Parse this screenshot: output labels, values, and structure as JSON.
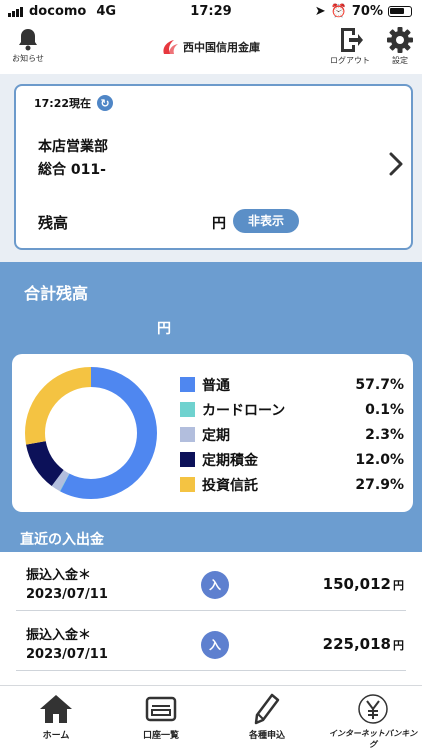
{
  "status_bar": {
    "carrier": "docomo",
    "network": "4G",
    "time": "17:29",
    "battery": "70%"
  },
  "header": {
    "notice_label": "お知らせ",
    "logo_text": "西中国信用金庫",
    "logout_label": "ログアウト",
    "settings_label": "設定"
  },
  "account_card": {
    "as_of": "17:22現在",
    "branch": "本店営業部",
    "account": "総合 011-",
    "balance_label": "残高",
    "currency": "円",
    "hide_label": "非表示"
  },
  "total": {
    "title": "合計残高",
    "currency": "円"
  },
  "chart_data": {
    "type": "pie",
    "title": "",
    "labels": [
      "普通",
      "カードローン",
      "定期",
      "定期積金",
      "投資信託"
    ],
    "values": [
      57.7,
      0.1,
      2.3,
      12.0,
      27.9
    ],
    "display_values": [
      "57.7%",
      "0.1%",
      "2.3%",
      "12.0%",
      "27.9%"
    ],
    "colors": [
      "#4f87f0",
      "#6fd2cf",
      "#b2bedd",
      "#0c1159",
      "#f4c342"
    ],
    "legend": "right"
  },
  "recent": {
    "title": "直近の入出金",
    "items": [
      {
        "label": "振込入金＊",
        "date": "2023/07/11",
        "type": "入",
        "amount": "150,012",
        "unit": "円"
      },
      {
        "label": "振込入金＊",
        "date": "2023/07/11",
        "type": "入",
        "amount": "225,018",
        "unit": "円"
      }
    ]
  },
  "nav": {
    "home": "ホーム",
    "accounts": "口座一覧",
    "applications": "各種申込",
    "internet_banking": "インターネットバンキング"
  }
}
